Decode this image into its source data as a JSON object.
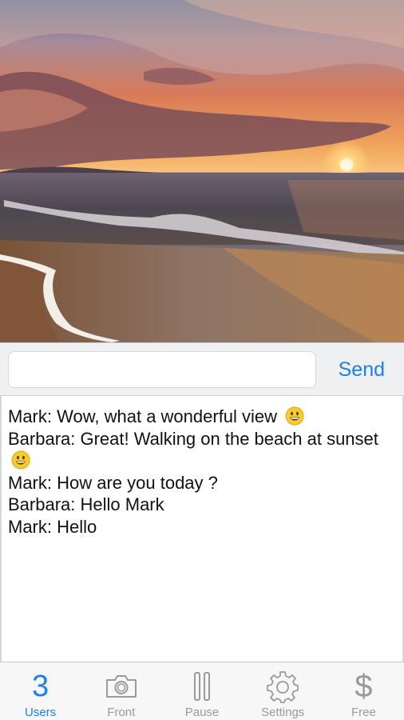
{
  "composer": {
    "input_value": "",
    "input_placeholder": "",
    "send_label": "Send"
  },
  "chat": {
    "messages": [
      {
        "text": "Mark: Wow, what a wonderful view",
        "emoji": "smiley-emoji"
      },
      {
        "text": "Barbara: Great! Walking on the beach at sunset",
        "emoji": "smiley-emoji"
      },
      {
        "text": "Mark: How are you today ?"
      },
      {
        "text": "Barbara: Hello Mark"
      },
      {
        "text": "Mark: Hello"
      }
    ]
  },
  "tabbar": {
    "tabs": [
      {
        "label": "Users",
        "value": "3",
        "icon": "users-count",
        "active": true
      },
      {
        "label": "Front",
        "icon": "camera-icon",
        "active": false
      },
      {
        "label": "Pause",
        "icon": "pause-icon",
        "active": false
      },
      {
        "label": "Settings",
        "icon": "gear-icon",
        "active": false
      },
      {
        "label": "Free",
        "value": "$",
        "icon": "dollar-icon",
        "active": false
      }
    ]
  },
  "colors": {
    "accent": "#1e7ff0",
    "inactive": "#9a9a9e",
    "composer_bg": "#eff0f2"
  }
}
